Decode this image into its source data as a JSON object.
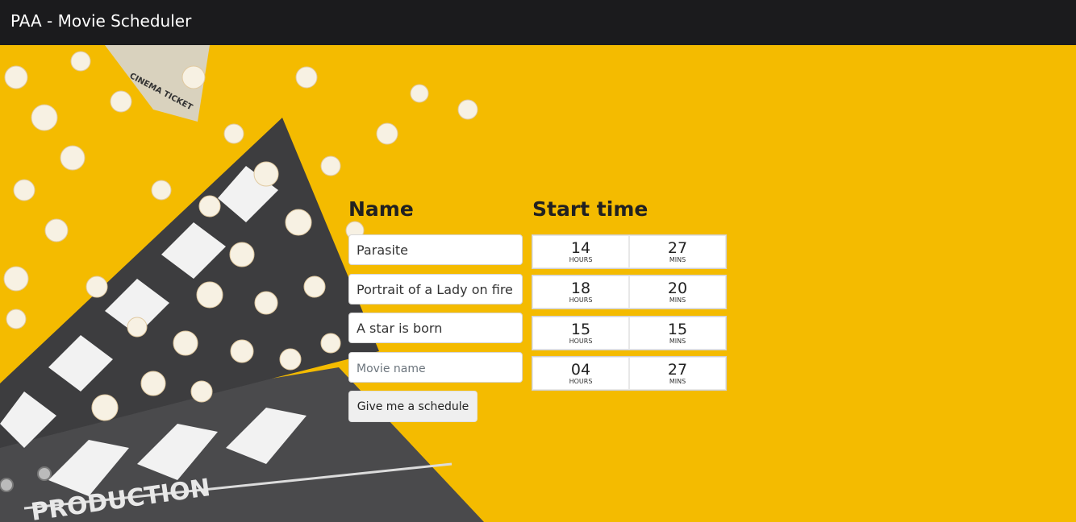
{
  "app": {
    "title": "PAA - Movie Scheduler"
  },
  "form": {
    "name_heading": "Name",
    "start_time_heading": "Start time",
    "movies": [
      {
        "name": "Parasite",
        "hours": "14",
        "mins": "27"
      },
      {
        "name": "Portrait of a Lady on fire",
        "hours": "18",
        "mins": "20"
      },
      {
        "name": "A star is born",
        "hours": "15",
        "mins": "15"
      },
      {
        "name": "",
        "hours": "04",
        "mins": "27"
      }
    ],
    "new_movie_placeholder": "Movie name",
    "hours_label": "HOURS",
    "mins_label": "MINS",
    "submit_label": "Give me a schedule"
  },
  "background": {
    "ticket_text": "CINEMA TICKET",
    "clapper_text": "PRODUCTION"
  },
  "colors": {
    "navbar": "#1b1b1d",
    "background": "#f4bb00",
    "button": "#efefef"
  }
}
